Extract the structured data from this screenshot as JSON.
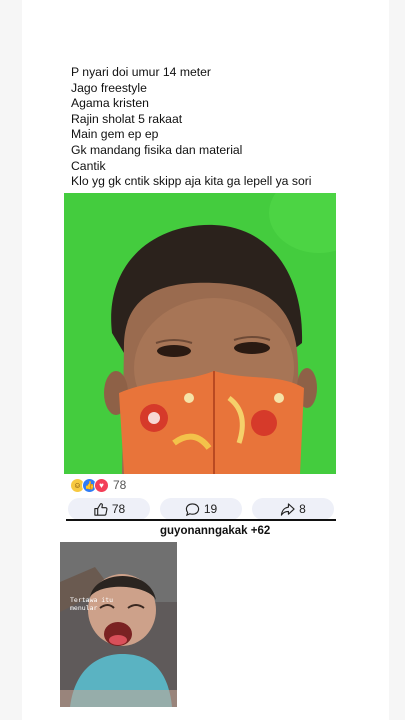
{
  "post": {
    "lines": [
      "P nyari doi umur 14 meter",
      "Jago freestyle",
      "Agama kristen",
      "Rajin sholat 5 rakaat",
      "Main gem ep ep",
      "Gk mandang fisika dan material",
      "Cantik",
      "Klo yg gk cntik skipp aja kita ga lepell ya sori"
    ]
  },
  "reactions": {
    "icons": [
      "haha-icon",
      "like-icon",
      "love-icon"
    ],
    "count": "78"
  },
  "actions": {
    "like_count": "78",
    "comment_count": "19",
    "share_count": "8"
  },
  "credit": "guyonanngakak +62",
  "video": {
    "caption": "Tertawa itu menular"
  },
  "colors": {
    "photo_background": "#44cc3e",
    "action_pill": "#eef0f8",
    "like_blue": "#2f7cf6",
    "love_red": "#f33e58",
    "haha_yellow": "#f7c940"
  }
}
